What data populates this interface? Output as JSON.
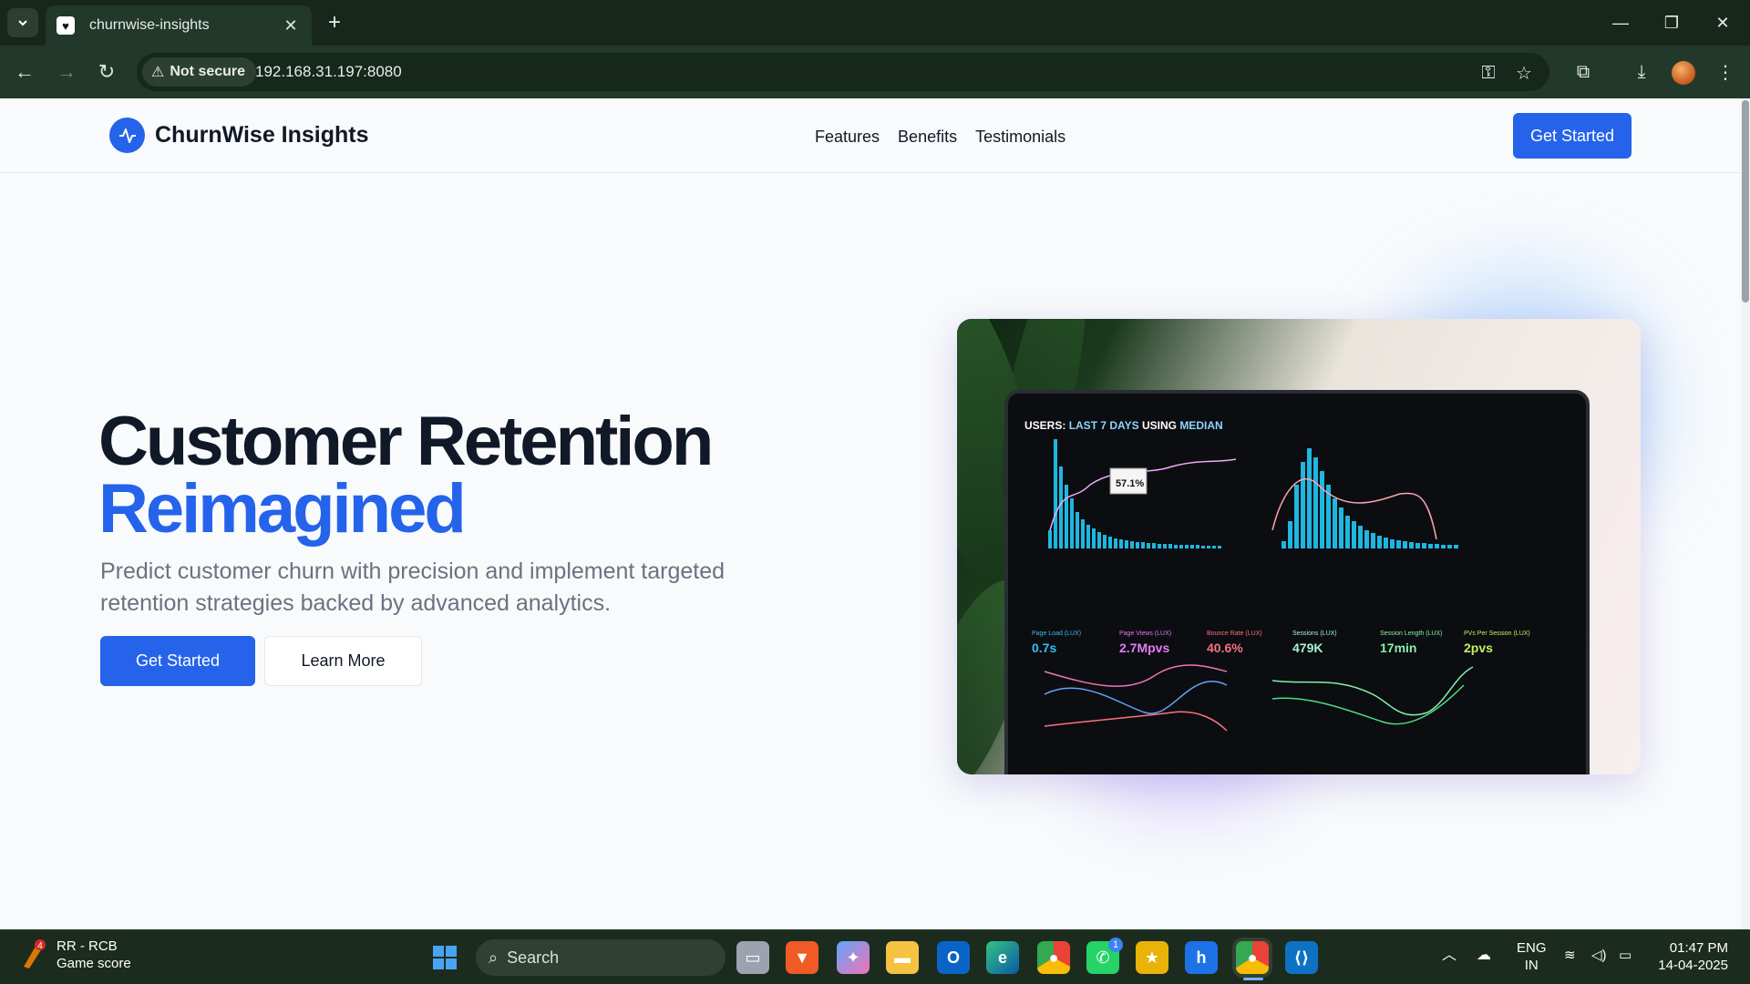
{
  "browser": {
    "tab_title": "churnwise-insights",
    "security_label": "Not secure",
    "url": "192.168.31.197:8080"
  },
  "site": {
    "brand": "ChurnWise Insights",
    "nav": [
      "Features",
      "Benefits",
      "Testimonials"
    ],
    "nav_cta": "Get Started"
  },
  "hero": {
    "title_line1": "Customer Retention",
    "title_line2": "Reimagined",
    "subtitle": "Predict customer churn with precision and implement targeted retention strategies backed by advanced analytics.",
    "primary_button": "Get Started",
    "secondary_button": "Learn More"
  },
  "dashboard_image": {
    "header_prefix": "USERS:",
    "header_range": "LAST 7 DAYS",
    "header_mid": "USING",
    "header_stat": "MEDIAN",
    "tooltip": "57.1%",
    "metrics": [
      {
        "label": "Page Load (LUX)",
        "value": "0.7s",
        "color": "#38bdf8"
      },
      {
        "label": "Page Views (LUX)",
        "value": "2.7Mpvs",
        "color": "#e879f9"
      },
      {
        "label": "Bounce Rate (LUX)",
        "value": "40.6%",
        "color": "#fb7185"
      },
      {
        "label": "Sessions (LUX)",
        "value": "479K",
        "color": "#a7f3d0"
      },
      {
        "label": "Session Length (LUX)",
        "value": "17min",
        "color": "#86efac"
      },
      {
        "label": "PVs Per Session (LUX)",
        "value": "2pvs",
        "color": "#bef264"
      }
    ]
  },
  "taskbar": {
    "widget_badge": "4",
    "widget_title": "RR - RCB",
    "widget_subtitle": "Game score",
    "search_placeholder": "Search",
    "whatsapp_badge": "1",
    "lang_line1": "ENG",
    "lang_line2": "IN",
    "time": "01:47 PM",
    "date": "14-04-2025"
  },
  "colors": {
    "accent": "#2563eb",
    "chrome_dark": "#17271c",
    "chrome_toolbar": "#22382a"
  }
}
